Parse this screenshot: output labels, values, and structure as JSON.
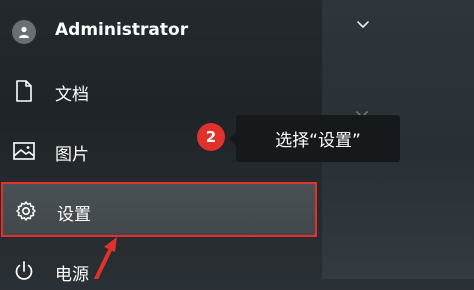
{
  "start_menu": {
    "user_name": "Administrator",
    "items": [
      {
        "label": "文档",
        "icon": "document-icon"
      },
      {
        "label": "图片",
        "icon": "pictures-icon"
      },
      {
        "label": "设置",
        "icon": "gear-icon"
      },
      {
        "label": "电源",
        "icon": "power-icon"
      }
    ]
  },
  "annotation": {
    "step_number": "2",
    "text": "选择“设置”",
    "highlight_color": "#e0312b"
  }
}
